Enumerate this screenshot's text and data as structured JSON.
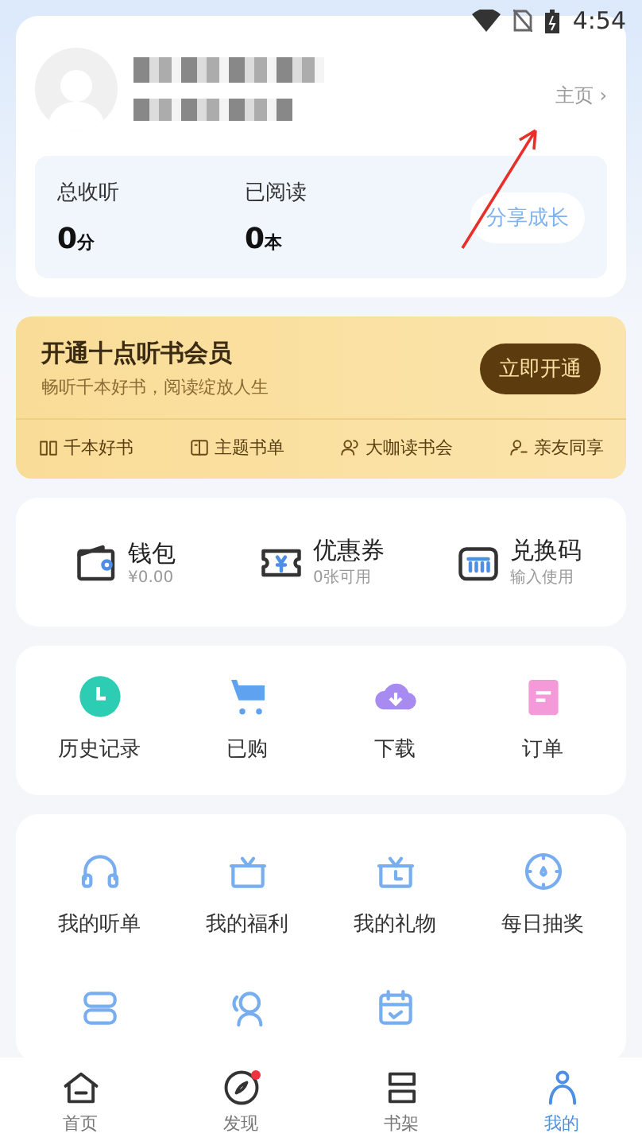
{
  "status_bar": {
    "time": "4:54"
  },
  "profile": {
    "home_link": "主页",
    "home_chevron": "›",
    "stats": [
      {
        "label": "总收听",
        "value": "0",
        "unit": "分"
      },
      {
        "label": "已阅读",
        "value": "0",
        "unit": "本"
      }
    ],
    "share_button": "分享成长"
  },
  "vip": {
    "title": "开通十点听书会员",
    "subtitle": "畅听千本好书，阅读绽放人生",
    "button": "立即开通",
    "perks": [
      "千本好书",
      "主题书单",
      "大咖读书会",
      "亲友同享"
    ]
  },
  "wallet": [
    {
      "title": "钱包",
      "sub": "¥0.00"
    },
    {
      "title": "优惠券",
      "sub": "0张可用"
    },
    {
      "title": "兑换码",
      "sub": "输入使用"
    }
  ],
  "quick": [
    "历史记录",
    "已购",
    "下载",
    "订单"
  ],
  "services": [
    {
      "kind": "labeled",
      "label": "我的听单"
    },
    {
      "kind": "labeled",
      "label": "我的福利"
    },
    {
      "kind": "labeled",
      "label": "我的礼物"
    },
    {
      "kind": "labeled",
      "label": "每日抽奖"
    },
    {
      "kind": "icon_only"
    },
    {
      "kind": "icon_only"
    },
    {
      "kind": "icon_only"
    }
  ],
  "tabs": [
    {
      "label": "首页",
      "selected": false,
      "badge": false
    },
    {
      "label": "发现",
      "selected": false,
      "badge": true
    },
    {
      "label": "书架",
      "selected": false,
      "badge": false
    },
    {
      "label": "我的",
      "selected": true,
      "badge": false
    }
  ]
}
